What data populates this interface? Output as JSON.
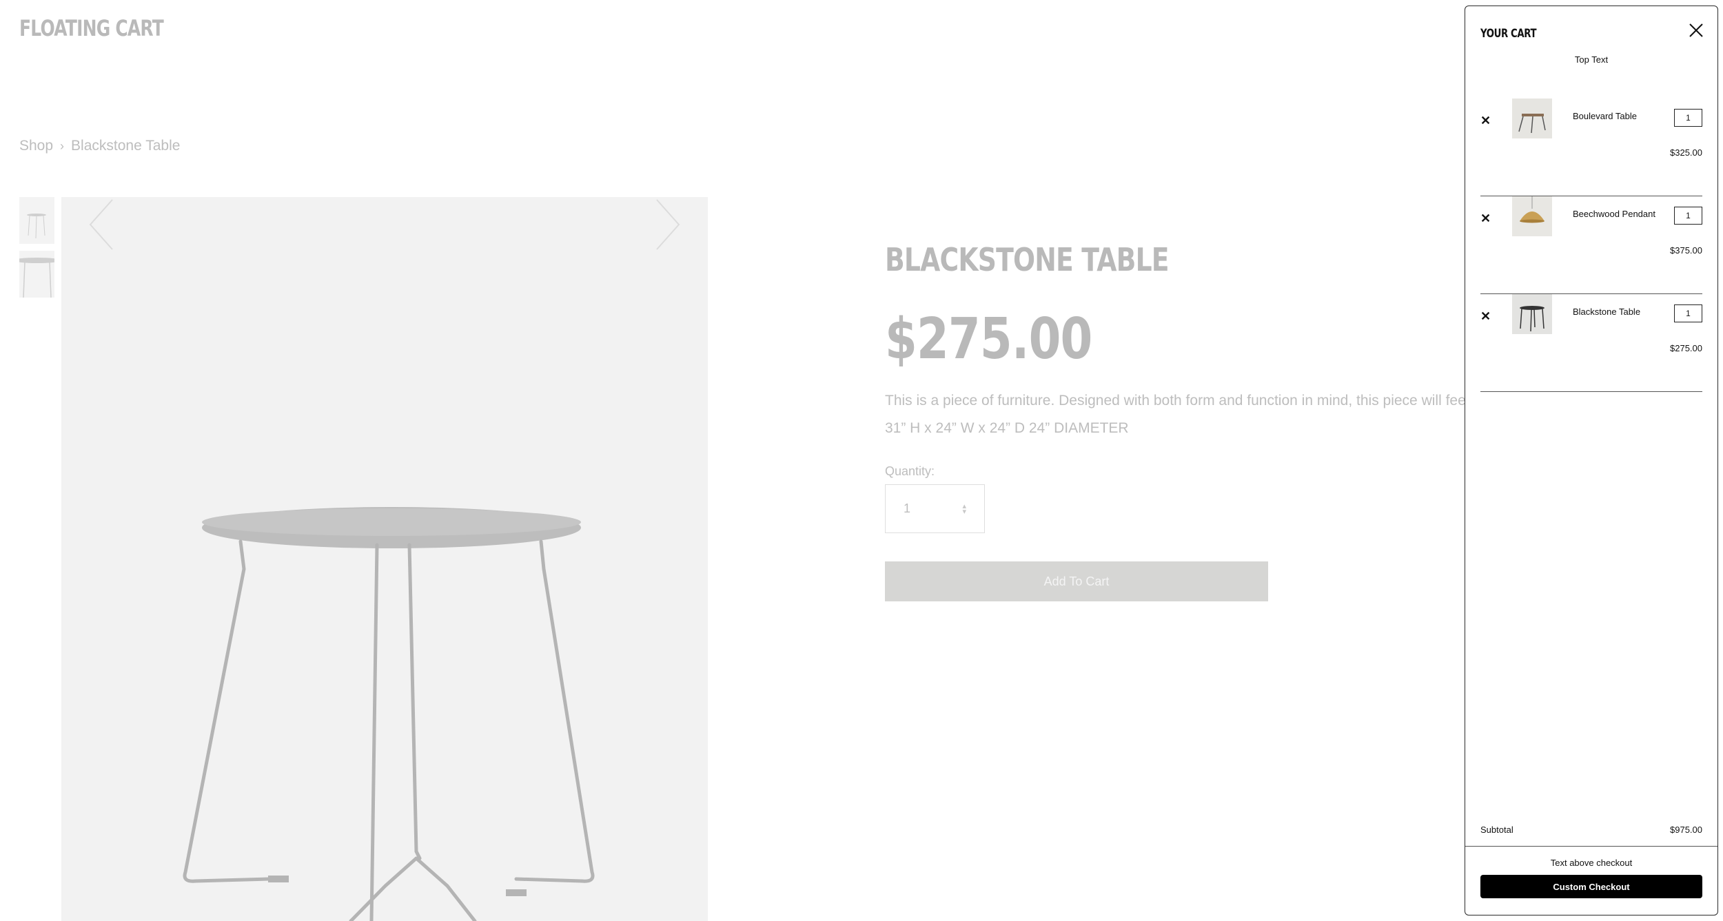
{
  "site": {
    "title": "FLOATING CART"
  },
  "breadcrumb": {
    "shop": "Shop",
    "separator": "›",
    "current": "Blackstone Table"
  },
  "product": {
    "title": "BLACKSTONE TABLE",
    "price": "$275.00",
    "description": "This is a piece of furniture. Designed with both form and function in mind, this piece will feel right at home",
    "dimensions": "31” H x 24” W x 24” D 24” DIAMETER",
    "quantity_label": "Quantity:",
    "quantity_value": "1",
    "add_to_cart_label": "Add To Cart"
  },
  "cart": {
    "title": "YOUR CART",
    "top_text": "Top Text",
    "items": [
      {
        "name": "Boulevard Table",
        "quantity": "1",
        "price": "$325.00"
      },
      {
        "name": "Beechwood Pendant",
        "quantity": "1",
        "price": "$375.00"
      },
      {
        "name": "Blackstone Table",
        "quantity": "1",
        "price": "$275.00"
      }
    ],
    "remove_glyph": "✕",
    "subtotal_label": "Subtotal",
    "subtotal_value": "$975.00",
    "above_checkout_text": "Text above checkout",
    "checkout_label": "Custom Checkout"
  },
  "icons": {
    "close": "close-icon",
    "remove": "remove-icon",
    "prev": "chevron-left-icon",
    "next": "chevron-right-icon"
  },
  "colors": {
    "dimmed_text": "#bdbdbd",
    "add_button_bg": "#d6d6d4",
    "checkout_button_bg": "#000000",
    "pendant_gold": "#c9a055"
  }
}
